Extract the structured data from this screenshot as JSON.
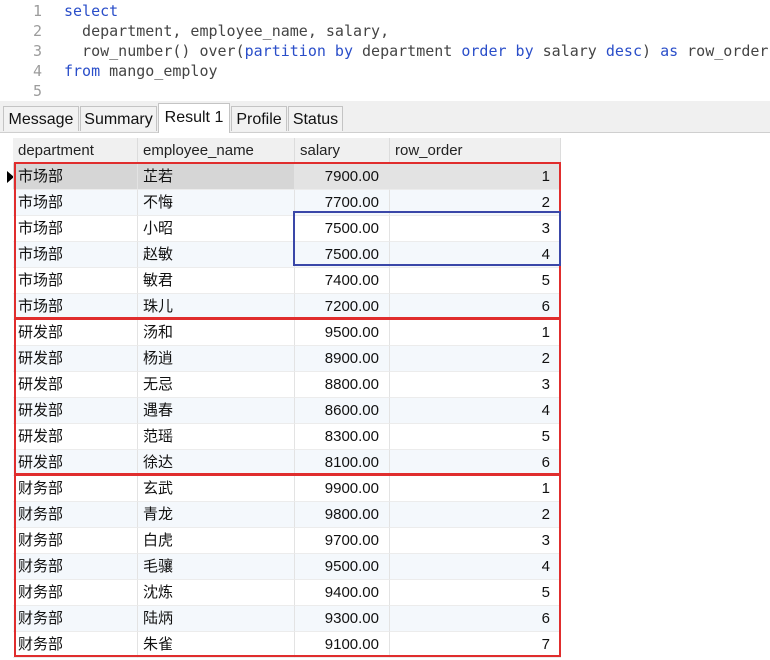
{
  "editor": {
    "lines": [
      {
        "num": "1",
        "segments": [
          {
            "t": "select",
            "kw": true
          }
        ]
      },
      {
        "num": "2",
        "segments": [
          {
            "t": "  department, employee_name, salary,",
            "kw": false
          }
        ]
      },
      {
        "num": "3",
        "segments": [
          {
            "t": "  row_number() over(",
            "kw": false
          },
          {
            "t": "partition by",
            "kw": true
          },
          {
            "t": " department ",
            "kw": false
          },
          {
            "t": "order by",
            "kw": true
          },
          {
            "t": " salary ",
            "kw": false
          },
          {
            "t": "desc",
            "kw": true
          },
          {
            "t": ") ",
            "kw": false
          },
          {
            "t": "as",
            "kw": true
          },
          {
            "t": " row_order",
            "kw": false
          }
        ]
      },
      {
        "num": "4",
        "segments": [
          {
            "t": "from",
            "kw": true
          },
          {
            "t": " mango_employ",
            "kw": false
          }
        ]
      },
      {
        "num": "5",
        "segments": []
      }
    ]
  },
  "tabs": {
    "message": "Message",
    "summary": "Summary",
    "result1": "Result 1",
    "profile": "Profile",
    "status": "Status"
  },
  "table": {
    "columns": [
      "department",
      "employee_name",
      "salary",
      "row_order"
    ],
    "rows": [
      [
        "市场部",
        "芷若",
        "7900.00",
        "1"
      ],
      [
        "市场部",
        "不悔",
        "7700.00",
        "2"
      ],
      [
        "市场部",
        "小昭",
        "7500.00",
        "3"
      ],
      [
        "市场部",
        "赵敏",
        "7500.00",
        "4"
      ],
      [
        "市场部",
        "敏君",
        "7400.00",
        "5"
      ],
      [
        "市场部",
        "珠儿",
        "7200.00",
        "6"
      ],
      [
        "研发部",
        "汤和",
        "9500.00",
        "1"
      ],
      [
        "研发部",
        "杨逍",
        "8900.00",
        "2"
      ],
      [
        "研发部",
        "无忌",
        "8800.00",
        "3"
      ],
      [
        "研发部",
        "遇春",
        "8600.00",
        "4"
      ],
      [
        "研发部",
        "范瑶",
        "8300.00",
        "5"
      ],
      [
        "研发部",
        "徐达",
        "8100.00",
        "6"
      ],
      [
        "财务部",
        "玄武",
        "9900.00",
        "1"
      ],
      [
        "财务部",
        "青龙",
        "9800.00",
        "2"
      ],
      [
        "财务部",
        "白虎",
        "9700.00",
        "3"
      ],
      [
        "财务部",
        "毛骧",
        "9500.00",
        "4"
      ],
      [
        "财务部",
        "沈炼",
        "9400.00",
        "5"
      ],
      [
        "财务部",
        "陆炳",
        "9300.00",
        "6"
      ],
      [
        "财务部",
        "朱雀",
        "9100.00",
        "7"
      ]
    ]
  },
  "colors": {
    "keyword": "#2a4ec9",
    "partition_box": "#e02d2d",
    "tie_box": "#3a47a8",
    "selected_row": "#d6d6d6"
  }
}
